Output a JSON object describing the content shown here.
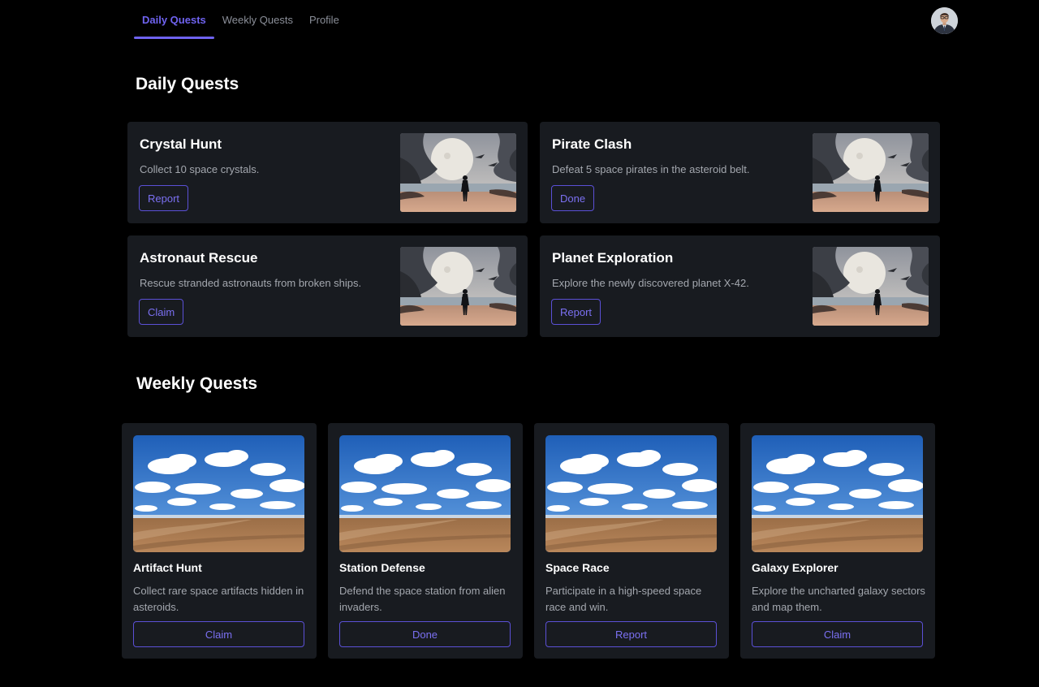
{
  "nav": {
    "tabs": [
      {
        "label": "Daily Quests",
        "active": true
      },
      {
        "label": "Weekly Quests",
        "active": false
      },
      {
        "label": "Profile",
        "active": false
      }
    ]
  },
  "user": {
    "avatar_icon": "user-avatar"
  },
  "daily": {
    "title": "Daily Quests",
    "quests": [
      {
        "title": "Crystal Hunt",
        "description": "Collect 10 space crystals.",
        "action": "Report",
        "image": "moon-warrior-landscape"
      },
      {
        "title": "Pirate Clash",
        "description": "Defeat 5 space pirates in the asteroid belt.",
        "action": "Done",
        "image": "moon-warrior-landscape"
      },
      {
        "title": "Astronaut Rescue",
        "description": "Rescue stranded astronauts from broken ships.",
        "action": "Claim",
        "image": "moon-warrior-landscape"
      },
      {
        "title": "Planet Exploration",
        "description": "Explore the newly discovered planet X-42.",
        "action": "Report",
        "image": "moon-warrior-landscape"
      }
    ]
  },
  "weekly": {
    "title": "Weekly Quests",
    "quests": [
      {
        "title": "Artifact Hunt",
        "description": "Collect rare space artifacts hidden in asteroids.",
        "action": "Claim",
        "image": "sky-field-landscape"
      },
      {
        "title": "Station Defense",
        "description": "Defend the space station from alien invaders.",
        "action": "Done",
        "image": "sky-field-landscape"
      },
      {
        "title": "Space Race",
        "description": "Participate in a high-speed space race and win.",
        "action": "Report",
        "image": "sky-field-landscape"
      },
      {
        "title": "Galaxy Explorer",
        "description": "Explore the uncharted galaxy sectors and map them.",
        "action": "Claim",
        "image": "sky-field-landscape"
      }
    ]
  },
  "colors": {
    "accent": "#6f63f0",
    "card_bg": "#181b20",
    "page_bg": "#000000"
  }
}
